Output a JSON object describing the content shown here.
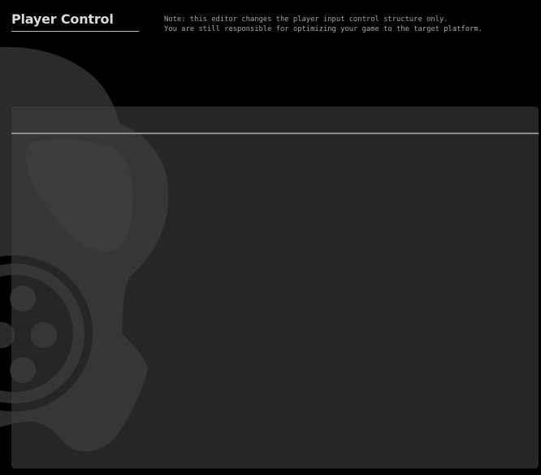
{
  "header": {
    "title": "Player Control",
    "note_lines": [
      "Note: this editor changes the player input control structure only.",
      "You are still responsible for optimizing your game to the target platform."
    ]
  },
  "panel": {
    "header_label": "",
    "items": []
  },
  "background": {
    "icon": "gamepad-icon",
    "color": "#2e2e2e"
  },
  "colors": {
    "page_bg": "#000000",
    "title_text": "#d9d9d9",
    "note_text": "#a6a6a6",
    "panel_bg": "#262626",
    "divider": "#8c8c8c"
  }
}
